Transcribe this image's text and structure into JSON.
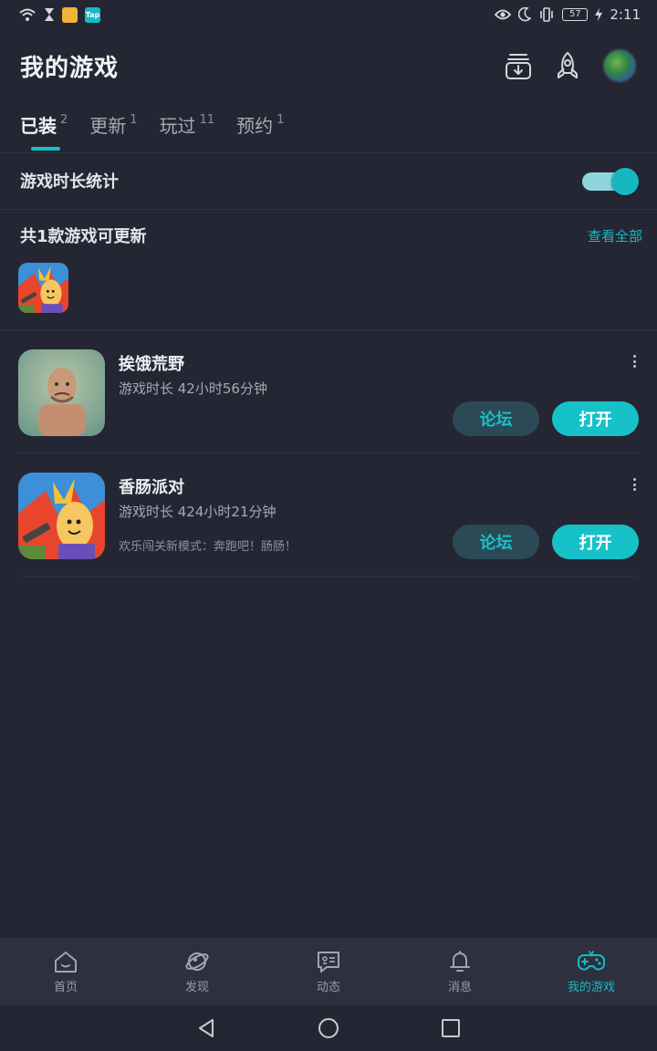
{
  "status_bar": {
    "tap_badge": "Tap",
    "battery": "57",
    "time": "2:11"
  },
  "header": {
    "title": "我的游戏"
  },
  "tabs": [
    {
      "label": "已装",
      "count": "2"
    },
    {
      "label": "更新",
      "count": "1"
    },
    {
      "label": "玩过",
      "count": "11"
    },
    {
      "label": "预约",
      "count": "1"
    }
  ],
  "playtime_stat": {
    "label": "游戏时长统计",
    "enabled": true
  },
  "updates": {
    "title": "共1款游戏可更新",
    "view_all": "查看全部"
  },
  "games": [
    {
      "name": "挨饿荒野",
      "playtime": "游戏时长 42小时56分钟",
      "note": "",
      "forum_label": "论坛",
      "open_label": "打开"
    },
    {
      "name": "香肠派对",
      "playtime": "游戏时长 424小时21分钟",
      "note": "欢乐闯关新模式：奔跑吧！肠肠！",
      "forum_label": "论坛",
      "open_label": "打开"
    }
  ],
  "bottom_nav": [
    {
      "label": "首页",
      "icon": "home-icon"
    },
    {
      "label": "发现",
      "icon": "planet-icon"
    },
    {
      "label": "动态",
      "icon": "chat-card-icon"
    },
    {
      "label": "消息",
      "icon": "bell-icon"
    },
    {
      "label": "我的游戏",
      "icon": "gamepad-icon"
    }
  ],
  "colors": {
    "background": "#242733",
    "accent": "#16c2c8",
    "nav_bar": "#2d303d"
  }
}
